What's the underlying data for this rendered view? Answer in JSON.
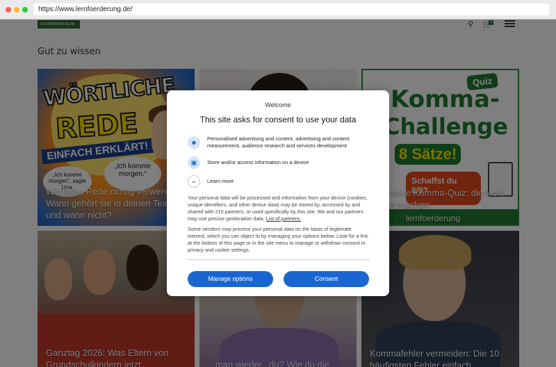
{
  "browser": {
    "url": "https://www.lernfoerderung.de/"
  },
  "header": {
    "logo_text": "Lernfoerderung.de",
    "cart_count": "0",
    "icons": [
      "search-icon",
      "cart-icon",
      "menu-icon"
    ]
  },
  "section": {
    "title": "Gut zu wissen"
  },
  "cards": [
    {
      "title": "Wörtliche Rede richtig verwenden: Wann gehört sie in deinen Text – und wann nicht?",
      "art": {
        "line1": "WÖRTLICHE",
        "line2": "REDE",
        "line3": "EINFACH ERKLÄRT!",
        "bubble_left": "„Ich komme morgen“, sagte Lina.",
        "bubble_right": "„Ich komme morgen.“"
      }
    },
    {
      "title": ""
    },
    {
      "title": "Ultimative Komma-Quiz: die viele falsch machen",
      "art": {
        "quiz": "Quiz",
        "line1": "Komma-",
        "line2": "Challenge",
        "badge": "8 Sätze!",
        "schaffst": "Schaffst du 8/8?",
        "footer": "lernfoerderung"
      }
    },
    {
      "title": "Ganztag 2026: Was Eltern von Grundschulkindern jetzt"
    },
    {
      "title": "...man wieder...du? Wie du die"
    },
    {
      "title": "Kommafehler vermeiden: Die 10 häufigsten Fehler einfach"
    }
  ],
  "consent": {
    "welcome": "Welcome",
    "heading": "This site asks for consent to use your data",
    "purposes": [
      {
        "icon": "person-icon",
        "label": "Personalised advertising and content, advertising and content measurement, audience research and services development"
      },
      {
        "icon": "device-icon",
        "label": "Store and/or access information on a device"
      },
      {
        "icon": "chevron-down-icon",
        "label": "Learn more"
      }
    ],
    "paragraph1": "Your personal data will be processed and information from your device (cookies, unique identifiers, and other device data) may be stored by, accessed by and shared with 210 partners, or used specifically by this site. We and our partners may use precise geolocation data.",
    "partners_link": "List of partners.",
    "paragraph2": "Some vendors may process your personal data on the basis of legitimate interest, which you can object to by managing your options below. Look for a link at the bottom of this page or in the site menu to manage or withdraw consent in privacy and cookie settings.",
    "manage_button": "Manage options",
    "consent_button": "Consent"
  },
  "colors": {
    "brand_green": "#2e6b34",
    "button_blue": "#1a66d0",
    "overlay": "rgba(0,0,0,0.5)"
  }
}
